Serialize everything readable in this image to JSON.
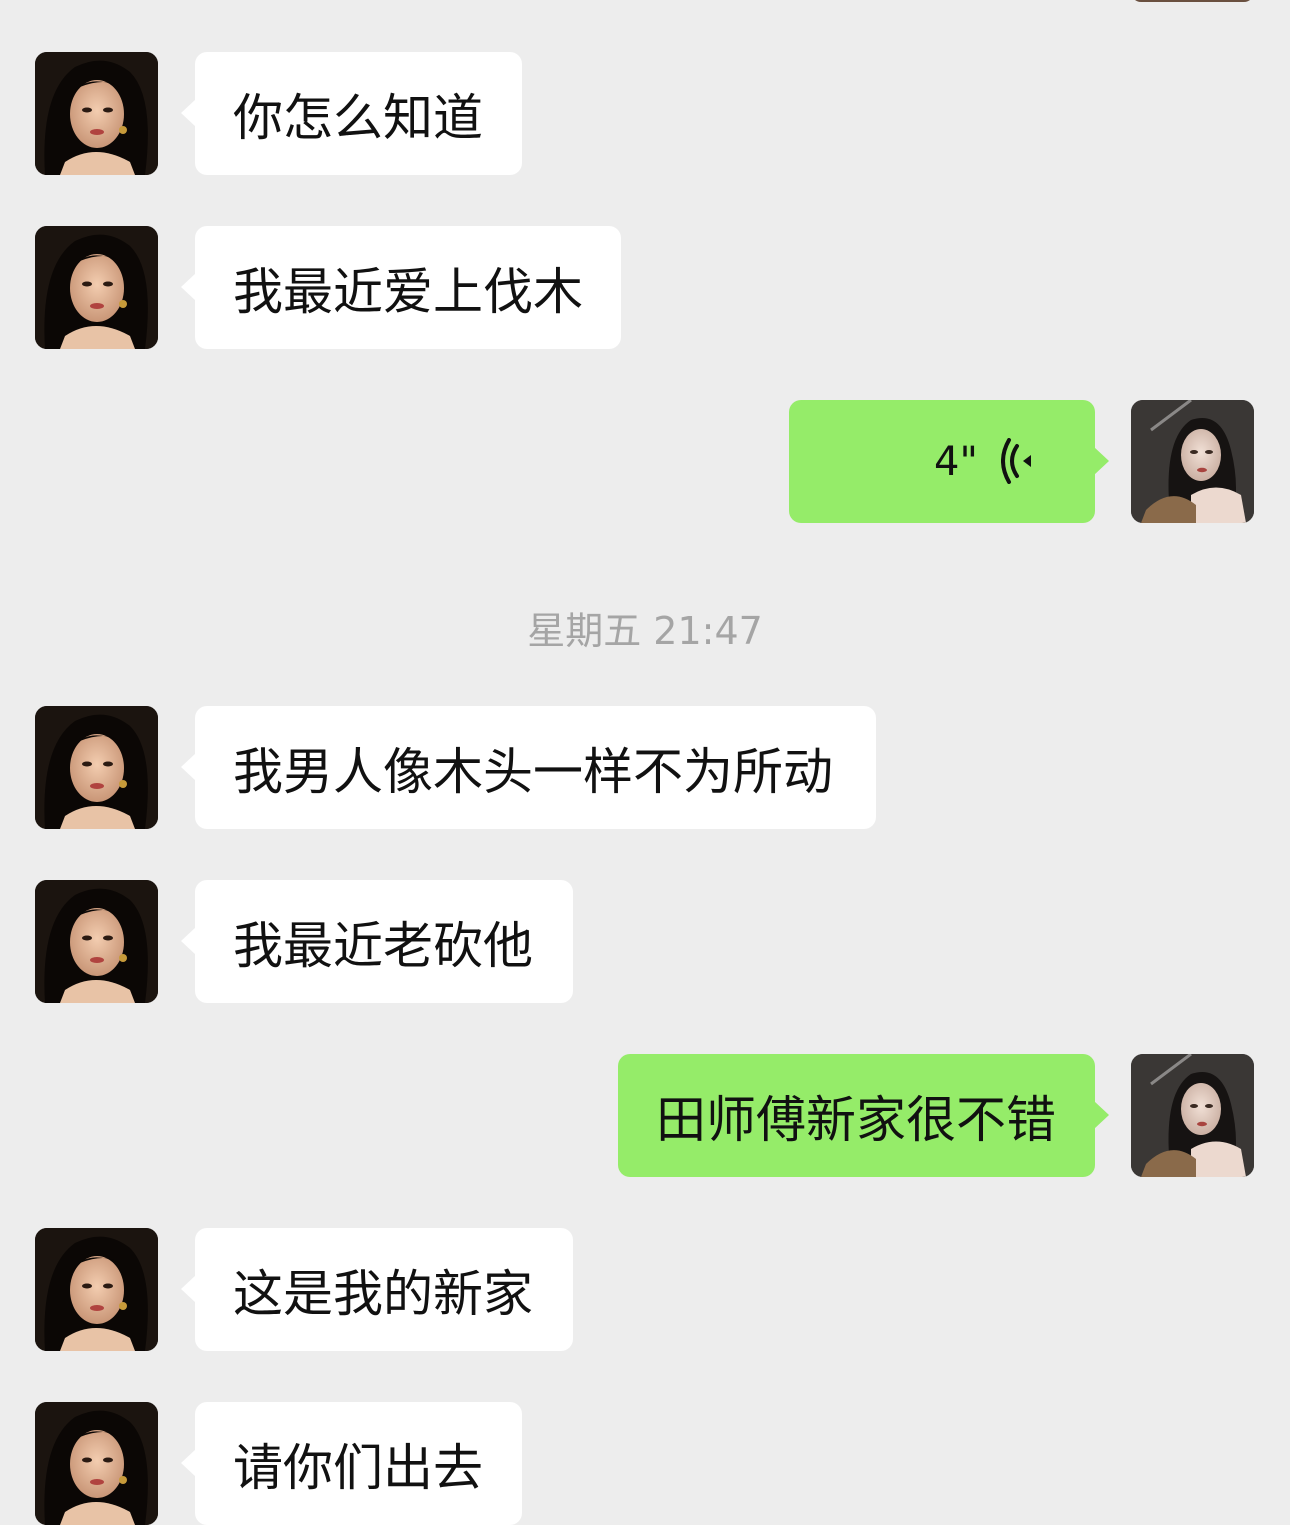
{
  "timestamp": "星期五 21:47",
  "messages": [
    {
      "side": "left",
      "text": "你怎么知道"
    },
    {
      "side": "left",
      "text": "我最近爱上伐木"
    },
    {
      "side": "right",
      "type": "voice",
      "duration": "4\""
    },
    {
      "side": "left",
      "text": "我男人像木头一样不为所动"
    },
    {
      "side": "left",
      "text": "我最近老砍他"
    },
    {
      "side": "right",
      "text": "田师傅新家很不错"
    },
    {
      "side": "left",
      "text": "这是我的新家"
    },
    {
      "side": "left",
      "text": "请你们出去"
    }
  ],
  "colors": {
    "background": "#ededed",
    "incoming_bubble": "#ffffff",
    "outgoing_bubble": "#95ec69",
    "timestamp_text": "#a5a5a5"
  }
}
